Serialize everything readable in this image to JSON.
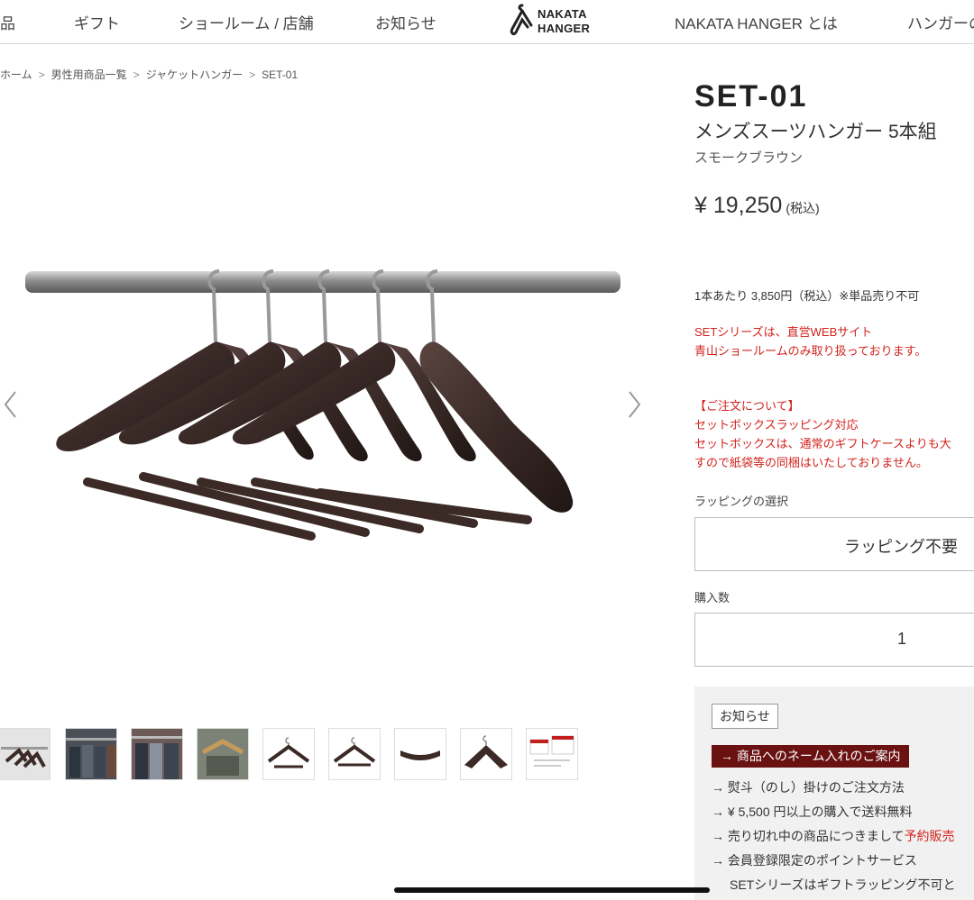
{
  "nav": {
    "items": [
      "品",
      "ギフト",
      "ショールーム / 店舗",
      "お知らせ",
      "NAKATA HANGER とは",
      "ハンガーの"
    ],
    "logo_line1": "NAKATA",
    "logo_line2": "HANGER"
  },
  "breadcrumb": [
    "ホーム",
    "男性用商品一覧",
    "ジャケットハンガー",
    "SET-01"
  ],
  "breadcrumb_sep": ">",
  "product": {
    "model": "SET-01",
    "name": "メンズスーツハンガー 5本組",
    "color": "スモークブラウン",
    "price": "¥ 19,250",
    "price_tax": "(税込)",
    "per_unit": "1本あたり 3,850円（税込）※単品売り不可",
    "set_note": [
      "SETシリーズは、直営WEBサイト",
      "青山ショールームのみ取り扱っております。"
    ],
    "order_note": [
      "【ご注文について】",
      "セットボックスラッピング対応",
      "セットボックスは、通常のギフトケースよりも大",
      "すので紙袋等の同梱はいたしておりません。"
    ]
  },
  "wrapping": {
    "label": "ラッピングの選択",
    "value": "ラッピング不要"
  },
  "quantity": {
    "label": "購入数",
    "value": "1"
  },
  "news": {
    "tag": "お知らせ",
    "name_button": "→ 商品へのネーム入れのご案内",
    "lines": [
      "→ 熨斗（のし）掛けのご注文方法",
      "→ ¥ 5,500 円以上の購入で送料無料",
      "→ 売り切れ中の商品につきまして",
      "→ 会員登録限定のポイントサービス",
      "SETシリーズはギフトラッピング不可と"
    ],
    "line3_red": "予約販売"
  },
  "carousel": {
    "prev_icon": "chevron-left-icon",
    "next_icon": "chevron-right-icon"
  },
  "colors": {
    "accent_red": "#d2241e",
    "name_button_bg": "#6a1212",
    "hanger_wood": "#3b2a26"
  }
}
